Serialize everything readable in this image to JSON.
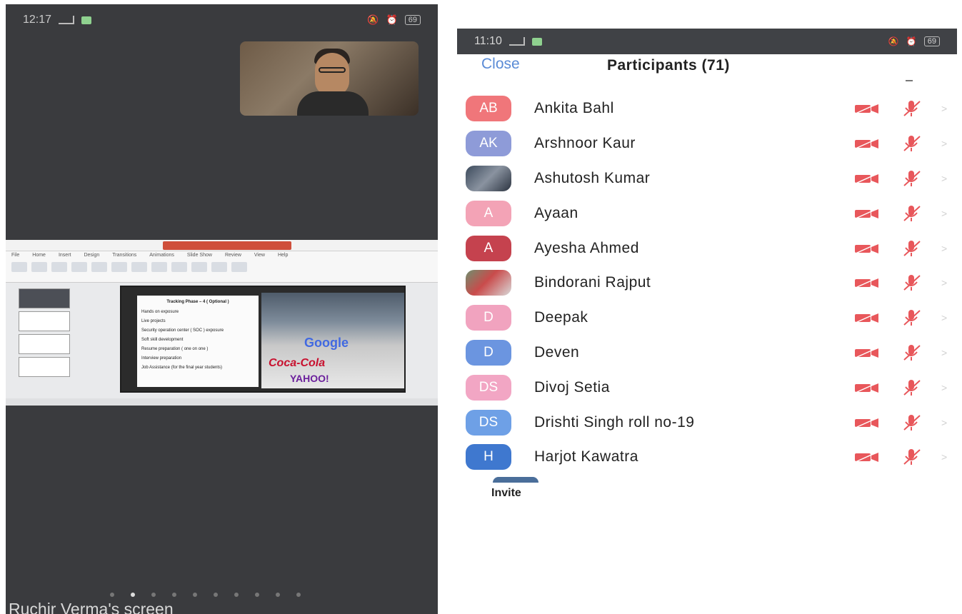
{
  "left_phone": {
    "status_time": "12:17",
    "status_battery": "69",
    "screen_label": "Ruchir Verma's screen",
    "page_dots": 10,
    "active_dot": 1,
    "slide": {
      "title": "Tracking Phase – 4 ( Optional )",
      "bullets": [
        "Hands on exposure",
        "Live projects",
        "Security operation center ( SOC ) exposure",
        "Soft skill development",
        "Resume preparation ( one on one )",
        "Interview preparation",
        "Job Assistance (for the final year students)"
      ],
      "logos": [
        "Google",
        "Coca-Cola",
        "YAHOO!"
      ]
    }
  },
  "right_phone": {
    "status_time": "11:10",
    "status_battery": "69",
    "close_label": "Close",
    "title": "Participants (71)",
    "invite_label": "Invite",
    "participants": [
      {
        "initials": "AB",
        "name": "Ankita Bahl",
        "color": "#f0767a"
      },
      {
        "initials": "AK",
        "name": "Arshnoor Kaur",
        "color": "#8e9bd8"
      },
      {
        "initials": "",
        "name": "Ashutosh Kumar",
        "color": "photo1"
      },
      {
        "initials": "A",
        "name": "Ayaan",
        "color": "#f3a3b6"
      },
      {
        "initials": "A",
        "name": "Ayesha Ahmed",
        "color": "#c5424e"
      },
      {
        "initials": "",
        "name": "Bindorani Rajput",
        "color": "photo2"
      },
      {
        "initials": "D",
        "name": "Deepak",
        "color": "#f1a3bf"
      },
      {
        "initials": "D",
        "name": "Deven",
        "color": "#6b95e0"
      },
      {
        "initials": "DS",
        "name": "Divoj Setia",
        "color": "#f2a6c4"
      },
      {
        "initials": "DS",
        "name": "Drishti Singh roll no-19",
        "color": "#6ea0e6"
      },
      {
        "initials": "H",
        "name": "Harjot Kawatra",
        "color": "#3f78cf"
      }
    ],
    "accent_red": "#e8575b"
  }
}
